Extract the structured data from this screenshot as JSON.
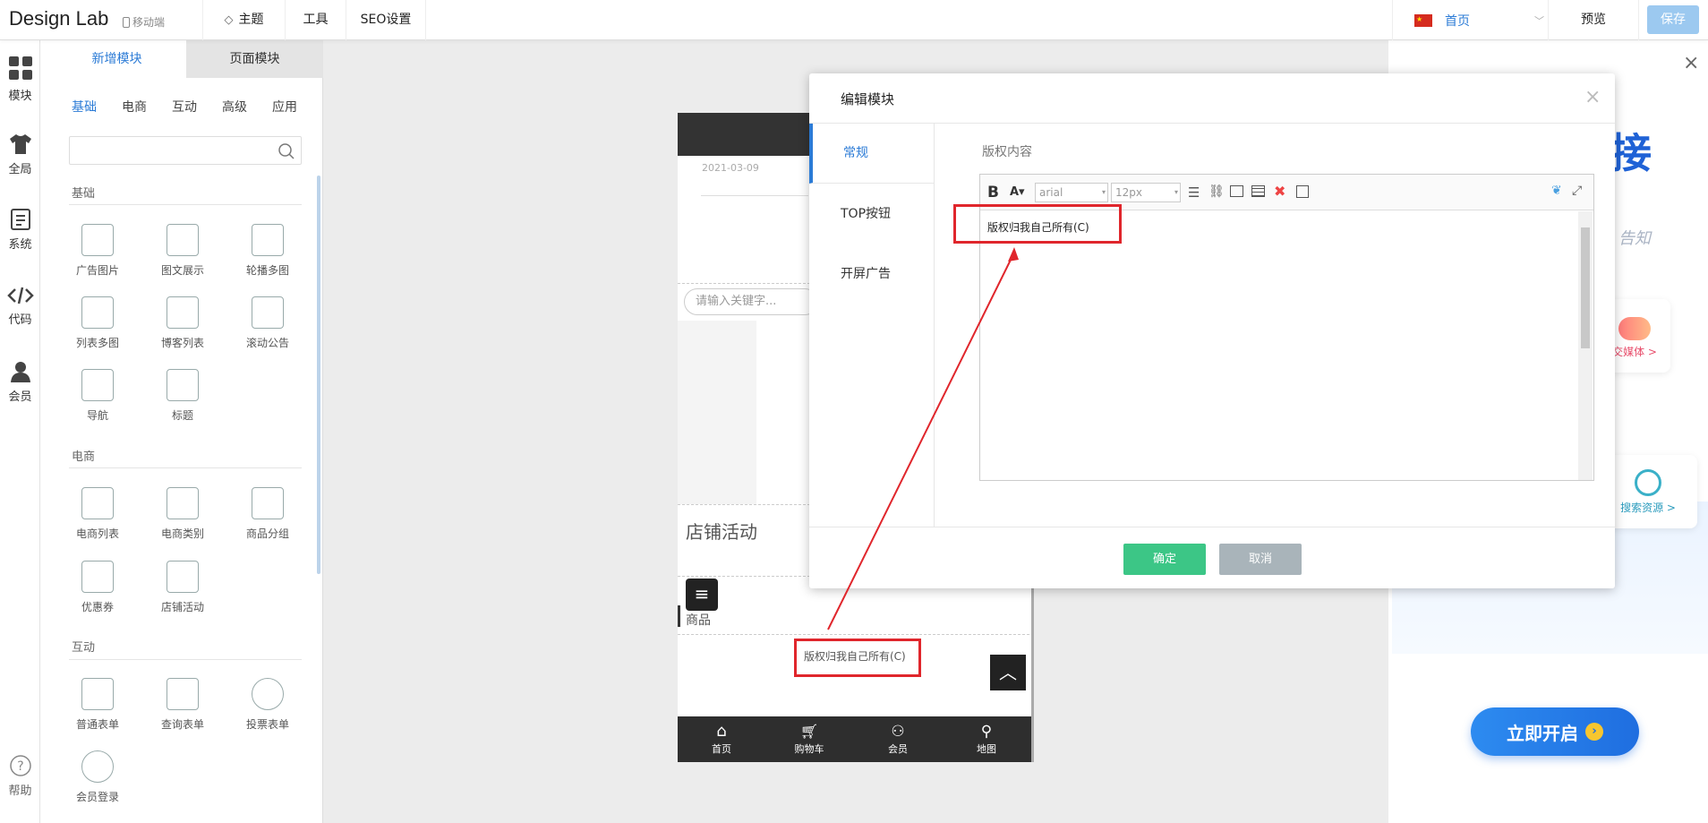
{
  "topbar": {
    "brand": "Design Lab",
    "mobile": "移动端",
    "nav": [
      "主题",
      "工具",
      "SEO设置"
    ],
    "language_page": "首页",
    "preview": "预览",
    "save": "保存"
  },
  "iconbar": [
    {
      "label": "模块",
      "icon": "grid-icon"
    },
    {
      "label": "全局",
      "icon": "shirt-icon"
    },
    {
      "label": "系统",
      "icon": "document-icon"
    },
    {
      "label": "代码",
      "icon": "code-icon"
    },
    {
      "label": "会员",
      "icon": "user-icon"
    },
    {
      "label": "帮助",
      "icon": "help-icon"
    }
  ],
  "panel": {
    "tabs": [
      "新增模块",
      "页面模块"
    ],
    "categories": [
      "基础",
      "电商",
      "互动",
      "高级",
      "应用"
    ],
    "sections": {
      "basic": "基础",
      "ecommerce": "电商",
      "interact": "互动"
    },
    "basic_modules": [
      "广告图片",
      "图文展示",
      "轮播多图",
      "列表多图",
      "博客列表",
      "滚动公告",
      "导航",
      "标题"
    ],
    "ecommerce_modules": [
      "电商列表",
      "电商类别",
      "商品分组",
      "优惠券",
      "店铺活动"
    ],
    "interact_modules": [
      "普通表单",
      "查询表单",
      "投票表单",
      "会员登录"
    ]
  },
  "phone": {
    "date": "2021-03-09",
    "search_placeholder": "请输入关键字...",
    "store_activity": "店铺活动",
    "goods": "商品",
    "copyright": "版权归我自己所有(C)",
    "nav": [
      "首页",
      "购物车",
      "会员",
      "地图"
    ]
  },
  "dialog": {
    "title": "编辑模块",
    "side_tabs": [
      "常规",
      "TOP按钮",
      "开屏广告"
    ],
    "field_label": "版权内容",
    "font_family": "arial",
    "font_size": "12px",
    "content": "版权归我自己所有(C)",
    "confirm": "确定",
    "cancel": "取消"
  },
  "promo": {
    "heading_fragment": "接",
    "sub_fragment": "告知",
    "card1": "交媒体 >",
    "card2": "搜索资源 >",
    "cta": "立即开启"
  },
  "colors": {
    "accent": "#2b7bd6",
    "confirm": "#3cc686",
    "cancel": "#a9b4ba",
    "highlight": "#e0262c"
  }
}
